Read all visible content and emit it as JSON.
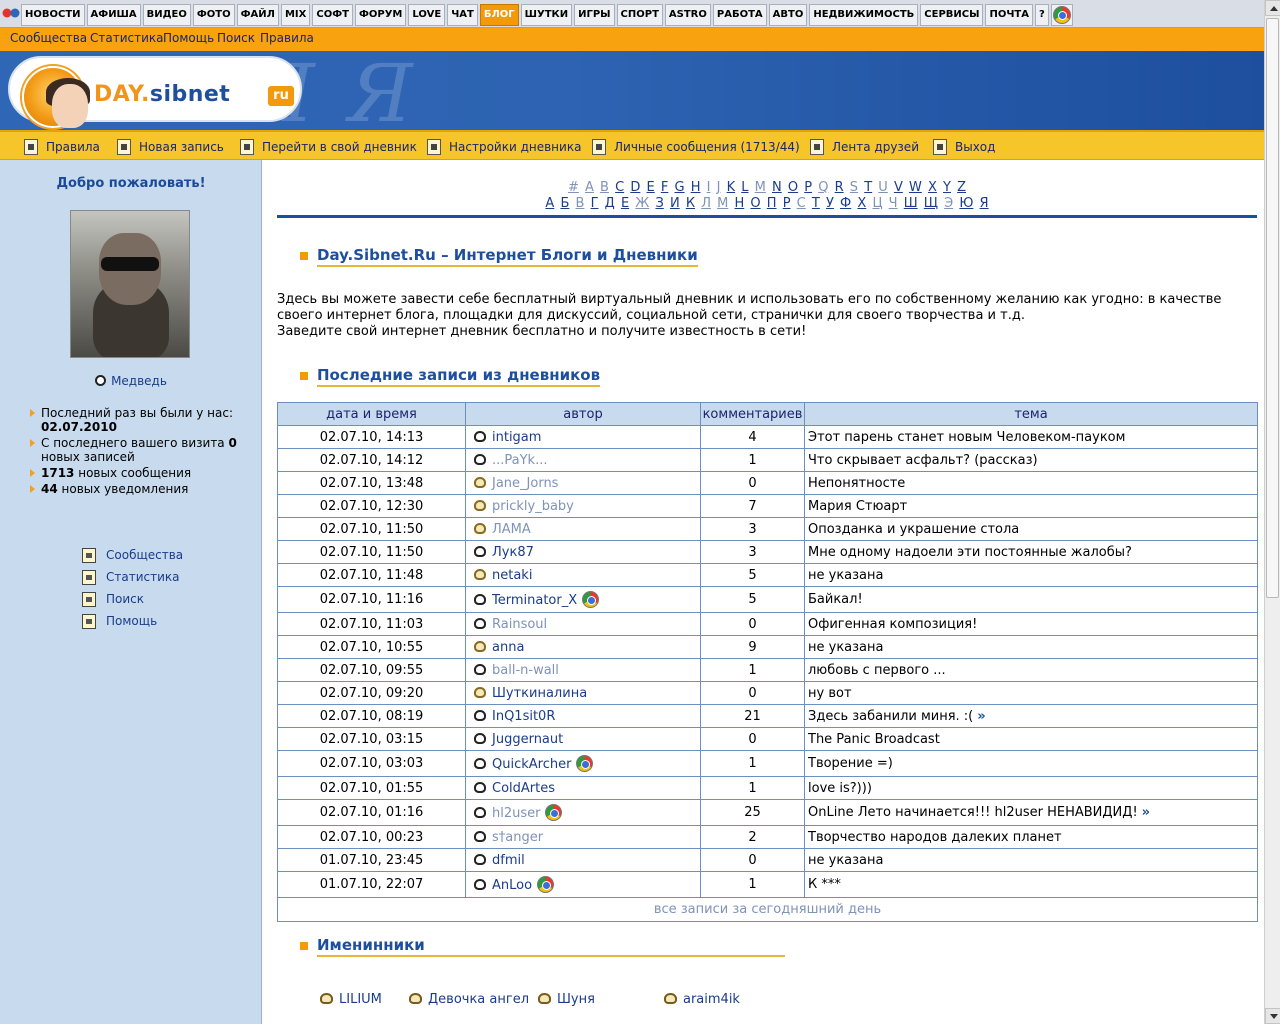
{
  "topnav": {
    "items": [
      "НОВОСТИ",
      "АФИША",
      "ВИДЕО",
      "ФОТО",
      "ФАЙЛ",
      "MIX",
      "СОФТ",
      "ФОРУМ",
      "LOVE",
      "ЧАТ",
      "БЛОГ",
      "ШУТКИ",
      "ИГРЫ",
      "СПОРТ",
      "ASTRO",
      "РАБОТА",
      "АВТО",
      "НЕДВИЖИМОСТЬ",
      "СЕРВИСЫ",
      "ПОЧТА",
      "?"
    ],
    "active": "БЛОГ"
  },
  "subbar": {
    "links": [
      "Сообщества",
      "Статистика",
      "Помощь",
      "Поиск",
      "Правила"
    ]
  },
  "banner": {
    "logo_day": "DAY.",
    "logo_sibnet": "sibnet",
    "logo_ru": "ru",
    "bg_letters": "Я Я"
  },
  "toolbar": {
    "items": [
      "Правила",
      "Новая запись",
      "Перейти в свой дневник",
      "Настройки дневника",
      "Личные сообщения (1713/44)",
      "Лента друзей",
      "Выход"
    ]
  },
  "sidebar": {
    "welcome": "Добро пожаловать!",
    "username": "Медведь",
    "stats": {
      "last_visit_label": "Последний раз вы были у нас:",
      "last_visit_date": "02.07.2010",
      "new_posts_label": "С последнего вашего визита",
      "new_posts_count": "0",
      "new_posts_suffix": "новых записей",
      "new_messages_count": "1713",
      "new_messages_suffix": "новых сообщения",
      "new_notices_count": "44",
      "new_notices_suffix": "новых уведомления"
    },
    "menu": [
      "Сообщества",
      "Статистика",
      "Поиск",
      "Помощь"
    ]
  },
  "alphabet": {
    "latin": [
      "#",
      "A",
      "B",
      "C",
      "D",
      "E",
      "F",
      "G",
      "H",
      "I",
      "J",
      "K",
      "L",
      "M",
      "N",
      "O",
      "P",
      "Q",
      "R",
      "S",
      "T",
      "U",
      "V",
      "W",
      "X",
      "Y",
      "Z"
    ],
    "latin_dim": [
      "#",
      "A",
      "B",
      "I",
      "J",
      "M",
      "Q",
      "S",
      "U"
    ],
    "cyrillic": [
      "А",
      "Б",
      "В",
      "Г",
      "Д",
      "Е",
      "Ж",
      "З",
      "И",
      "К",
      "Л",
      "М",
      "Н",
      "О",
      "П",
      "Р",
      "С",
      "Т",
      "У",
      "Ф",
      "Х",
      "Ц",
      "Ч",
      "Ш",
      "Щ",
      "Э",
      "Ю",
      "Я"
    ],
    "cyrillic_dim": [
      "В",
      "Ж",
      "Л",
      "М",
      "С",
      "Ц",
      "Ч",
      "Э"
    ]
  },
  "main": {
    "title": "Day.Sibnet.Ru – Интернет Блоги и Дневники",
    "intro_line1": "Здесь вы можете завести себе бесплатный виртуальный дневник и использовать его по собственному желанию как угодно: в качестве своего интернет блога, площадки для дискуссий, социальной сети, странички для своего творчества и т.д.",
    "intro_line2": "Заведите свой интернет дневник бесплатно и получите известность в сети!",
    "recent_title": "Последние записи из дневников",
    "columns": [
      "дата и время",
      "автор",
      "комментариев",
      "тема"
    ],
    "rows": [
      {
        "date": "02.07.10, 14:13",
        "author": "intigam",
        "dim": false,
        "f": false,
        "ext": false,
        "comments": "4",
        "topic": "Этот парень станет новым Человеком-пауком",
        "more": false
      },
      {
        "date": "02.07.10, 14:12",
        "author": "...PaYk...",
        "dim": true,
        "f": false,
        "ext": false,
        "comments": "1",
        "topic": "Что скрывает асфальт? (рассказ)",
        "more": false
      },
      {
        "date": "02.07.10, 13:48",
        "author": "Jane_Jorns",
        "dim": true,
        "f": true,
        "ext": false,
        "comments": "0",
        "topic": "Непонятносте",
        "more": false
      },
      {
        "date": "02.07.10, 12:30",
        "author": "prickly_baby",
        "dim": true,
        "f": true,
        "ext": false,
        "comments": "7",
        "topic": "Мария Стюарт",
        "more": false
      },
      {
        "date": "02.07.10, 11:50",
        "author": "ЛАМА",
        "dim": true,
        "f": true,
        "ext": false,
        "comments": "3",
        "topic": "Опозданка и украшение стола",
        "more": false
      },
      {
        "date": "02.07.10, 11:50",
        "author": "Лук87",
        "dim": false,
        "f": false,
        "ext": false,
        "comments": "3",
        "topic": "Мне одному надоели эти постоянные жалобы?",
        "more": false
      },
      {
        "date": "02.07.10, 11:48",
        "author": "netaki",
        "dim": false,
        "f": true,
        "ext": false,
        "comments": "5",
        "topic": "не указана",
        "more": false
      },
      {
        "date": "02.07.10, 11:16",
        "author": "Terminator_X",
        "dim": false,
        "f": false,
        "ext": true,
        "comments": "5",
        "topic": "Байкал!",
        "more": false
      },
      {
        "date": "02.07.10, 11:03",
        "author": "Rainsoul",
        "dim": true,
        "f": false,
        "ext": false,
        "comments": "0",
        "topic": "Офигенная композиция!",
        "more": false
      },
      {
        "date": "02.07.10, 10:55",
        "author": "anna",
        "dim": false,
        "f": true,
        "ext": false,
        "comments": "9",
        "topic": "не указана",
        "more": false
      },
      {
        "date": "02.07.10, 09:55",
        "author": "ball-n-wall",
        "dim": true,
        "f": false,
        "ext": false,
        "comments": "1",
        "topic": "любовь с первого ...",
        "more": false
      },
      {
        "date": "02.07.10, 09:20",
        "author": "Шуткиналина",
        "dim": false,
        "f": true,
        "ext": false,
        "comments": "0",
        "topic": "ну вот",
        "more": false
      },
      {
        "date": "02.07.10, 08:19",
        "author": "InQ1sit0R",
        "dim": false,
        "f": false,
        "ext": false,
        "comments": "21",
        "topic": "Здесь забанили миня. :(",
        "more": true
      },
      {
        "date": "02.07.10, 03:15",
        "author": "Juggernaut",
        "dim": false,
        "f": false,
        "ext": false,
        "comments": "0",
        "topic": "The Panic Broadcast",
        "more": false
      },
      {
        "date": "02.07.10, 03:03",
        "author": "QuickArcher",
        "dim": false,
        "f": false,
        "ext": true,
        "comments": "1",
        "topic": "Творение =)",
        "more": false
      },
      {
        "date": "02.07.10, 01:55",
        "author": "ColdArtes",
        "dim": false,
        "f": false,
        "ext": false,
        "comments": "1",
        "topic": "love is?)))",
        "more": false
      },
      {
        "date": "02.07.10, 01:16",
        "author": "hl2user",
        "dim": true,
        "f": false,
        "ext": true,
        "comments": "25",
        "topic": "OnLine Лето начинается!!! hl2user НЕНАВИДИД!",
        "more": true
      },
      {
        "date": "02.07.10, 00:23",
        "author": "s†anger",
        "dim": true,
        "f": false,
        "ext": false,
        "comments": "2",
        "topic": "Творчество народов далеких планет",
        "more": false
      },
      {
        "date": "01.07.10, 23:45",
        "author": "dfmil",
        "dim": false,
        "f": false,
        "ext": false,
        "comments": "0",
        "topic": "не указана",
        "more": false
      },
      {
        "date": "01.07.10, 22:07",
        "author": "AnLoo",
        "dim": false,
        "f": false,
        "ext": true,
        "comments": "1",
        "topic": "К ***",
        "more": false
      }
    ],
    "all_today": "все записи за сегодняшний день",
    "more_glyph": "»",
    "birthdays_title": "Именинники",
    "birthdays": [
      {
        "name": "LILIUM",
        "dim": false
      },
      {
        "name": "Девочка ангел",
        "dim": false
      },
      {
        "name": "Шуня",
        "dim": false
      },
      {
        "name": "araim4ik",
        "dim": false
      }
    ]
  }
}
